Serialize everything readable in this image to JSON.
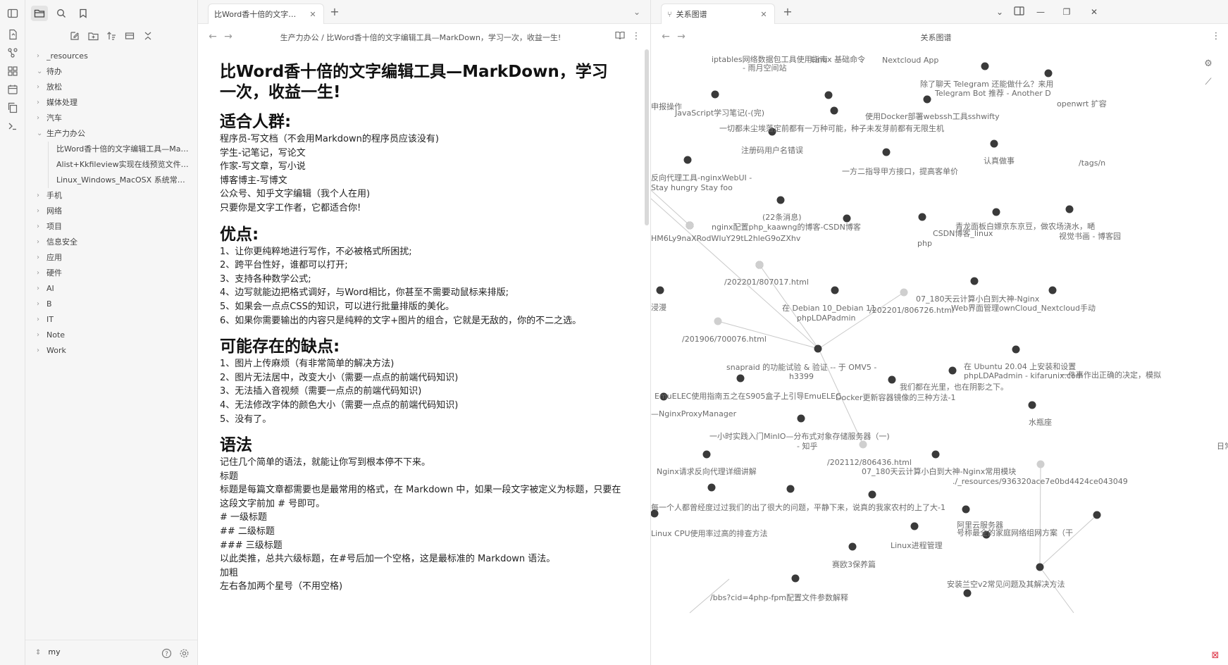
{
  "sidebar": {
    "tree": [
      {
        "label": "_resources",
        "expanded": false,
        "child": false
      },
      {
        "label": "待办",
        "expanded": true,
        "child": false
      },
      {
        "label": "放松",
        "expanded": false,
        "child": false
      },
      {
        "label": "媒体处理",
        "expanded": false,
        "child": false
      },
      {
        "label": "汽车",
        "expanded": false,
        "child": false
      },
      {
        "label": "生产力办公",
        "expanded": true,
        "child": false
      },
      {
        "label": "比Word香十倍的文字编辑工具—Mark...",
        "expanded": null,
        "child": true
      },
      {
        "label": "Alist+Kkfileview实现在线预览文件解...",
        "expanded": null,
        "child": true
      },
      {
        "label": "Linux_Windows_MacOSX 系统常用命...",
        "expanded": null,
        "child": true
      },
      {
        "label": "手机",
        "expanded": false,
        "child": false
      },
      {
        "label": "网络",
        "expanded": false,
        "child": false
      },
      {
        "label": "项目",
        "expanded": false,
        "child": false
      },
      {
        "label": "信息安全",
        "expanded": false,
        "child": false
      },
      {
        "label": "应用",
        "expanded": false,
        "child": false
      },
      {
        "label": "硬件",
        "expanded": false,
        "child": false
      },
      {
        "label": "AI",
        "expanded": false,
        "child": false
      },
      {
        "label": "B",
        "expanded": false,
        "child": false
      },
      {
        "label": "IT",
        "expanded": false,
        "child": false
      },
      {
        "label": "Note",
        "expanded": false,
        "child": false
      },
      {
        "label": "Work",
        "expanded": false,
        "child": false
      }
    ],
    "vault_name": "my"
  },
  "editor": {
    "tab_title": "比Word香十倍的文字编辑...",
    "breadcrumb": "生产力办公 / 比Word香十倍的文字编辑工具—MarkDown，学习一次，收益一生!",
    "doc": {
      "title": "比Word香十倍的文字编辑工具—MarkDown，学习一次，收益一生!",
      "sections": [
        {
          "heading": "适合人群:",
          "lines": [
            "程序员-写文档（不会用Markdown的程序员应该没有)",
            "学生-记笔记，写论文",
            "作家-写文章，写小说",
            "博客博主-写博文",
            "公众号、知乎文字编辑（我个人在用)",
            "只要你是文字工作者，它都适合你!"
          ]
        },
        {
          "heading": "优点:",
          "lines": [
            "1、让你更纯粹地进行写作，不必被格式所困扰;",
            "2、跨平台性好，谁都可以打开;",
            "3、支持各种数学公式;",
            "4、边写就能边把格式调好，与Word相比，你甚至不需要动鼠标来排版;",
            "5、如果会一点点CSS的知识，可以进行批量排版的美化。",
            "6、如果你需要输出的内容只是纯粹的文字+图片的组合，它就是无敌的，你的不二之选。"
          ]
        },
        {
          "heading": "可能存在的缺点:",
          "lines": [
            "1、图片上传麻烦（有非常简单的解决方法)",
            "2、图片无法居中，改变大小（需要一点点的前端代码知识)",
            "3、无法插入音视频（需要一点点的前端代码知识)",
            "4、无法修改字体的颜色大小（需要一点点的前端代码知识)",
            "5、没有了。"
          ]
        },
        {
          "heading": "语法",
          "lines": [
            "记住几个简单的语法，就能让你写到根本停不下来。",
            "标题",
            "标题是每篇文章都需要也是最常用的格式，在 Markdown 中，如果一段文字被定义为标题，只要在这段文字前加 # 号即可。",
            "# 一级标题",
            "## 二级标题",
            "### 三级标题",
            "以此类推，总共六级标题，在#号后加一个空格，这是最标准的 Markdown 语法。",
            "加粗",
            "左右各加两个星号（不用空格)"
          ]
        }
      ]
    }
  },
  "graph": {
    "tab_title": "关系图谱",
    "view_title": "关系图谱",
    "labels": [
      "iptables网络数据包工具使用指南",
      "Telegram Bot 推荐 - Another D",
      "Nextcloud App",
      "- 雨月空间站",
      "除了聊天 Telegram 还能做什么？来用",
      "Linux 基础命令",
      "openwrt 扩容",
      "申报操作",
      "JavaScript学习笔记(-(完)",
      "使用Docker部署webssh工具sshwifty",
      "一切都未尘埃落定前都有一万种可能，种子未发芽前都有无限生机",
      "注册码用户名错误",
      "认真做事",
      "/tags/n",
      "一方二指导甲方接口，提高客单价",
      "反向代理工具-nginxWebUI -",
      "Stay hungry Stay foo",
      "(22条消息)",
      "nginx配置php_kaawng的博客-CSDN博客",
      "青龙面板白嫖京东京豆，做农场浇水，嗮",
      "视觉书画 - 博客园",
      "CSDN博客_linux",
      "php",
      "HM6Ly9naXRodWIuY29tL2hleG9oZXhv",
      "/202201/807017.html",
      "/202201/806726.html",
      "07_180天云计算小白到大神-Nginx",
      "在 Debian 10_Debian 11",
      "phpLDAPadmin",
      "Web界面管理ownCloud_Nextcloud手动",
      "浸漫",
      "/201906/700076.html",
      "snapraid 的功能试验 & 验证 -- 于 OMV5 -",
      "h3399",
      "在 Ubuntu 20.04 上安装和设置",
      "phpLDAPadmin - kifarunix.com",
      "我们都在光里，也在阴影之下。",
      "一件事作出正确的决定，模拟",
      "EmuELEC使用指南五之在S905盒子上引导EmuELEC",
      "Docker更新容器镜像的三种方法-1",
      "—NginxProxyManager",
      "水瓶座",
      "一小时实践入门MinIO—分布式对象存储服务器（一)",
      "- 知乎",
      "日常",
      "/202112/806436.html",
      "07_180天云计算小白到大神-Nginx常用模块",
      "./_resources/936320ace7e0bd4424ce043049",
      "Nginx请求反向代理详细讲解",
      "每一个人都曾经度过过我们的出了很大的问题，平静下来，说真的我家农村的上了大-1",
      "阿里云服务器",
      "号称最全的家庭网络组网方案（干",
      "Linux CPU使用率过高的排查方法",
      "Linux进程管理",
      "赛欧3保养篇",
      "安装兰空v2常见问题及其解决方法",
      "/bbs?cid=4php-fpm配置文件参数解释"
    ]
  }
}
